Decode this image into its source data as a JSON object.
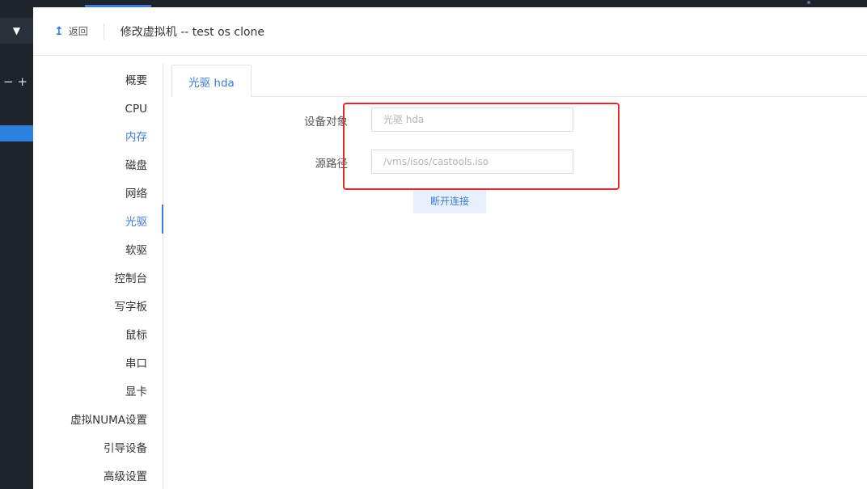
{
  "top_rail": {
    "zoom_out": "−",
    "zoom_in": "+",
    "dropdown_icon": "caret-down-icon"
  },
  "header": {
    "back_label": "返回",
    "back_icon": "arrow-up-icon",
    "title": "修改虚拟机 -- test os clone"
  },
  "sidenav": {
    "active": "光驱",
    "items": [
      {
        "label": "概要"
      },
      {
        "label": "CPU"
      },
      {
        "label": "内存"
      },
      {
        "label": "磁盘"
      },
      {
        "label": "网络"
      },
      {
        "label": "光驱"
      },
      {
        "label": "软驱"
      },
      {
        "label": "控制台"
      },
      {
        "label": "写字板"
      },
      {
        "label": "鼠标"
      },
      {
        "label": "串口"
      },
      {
        "label": "显卡"
      },
      {
        "label": "虚拟NUMA设置"
      },
      {
        "label": "引导设备"
      },
      {
        "label": "高级设置"
      }
    ]
  },
  "tabs": [
    {
      "label": "光驱 hda"
    }
  ],
  "form": {
    "device_label": "设备对象",
    "device_placeholder": "光驱 hda",
    "source_label": "源路径",
    "source_placeholder": "/vms/isos/castools.iso",
    "disconnect_label": "断开连接"
  },
  "colors": {
    "accent": "#3a7bd5",
    "annotation": "#e8262b",
    "dark_rail": "#1f242c"
  }
}
